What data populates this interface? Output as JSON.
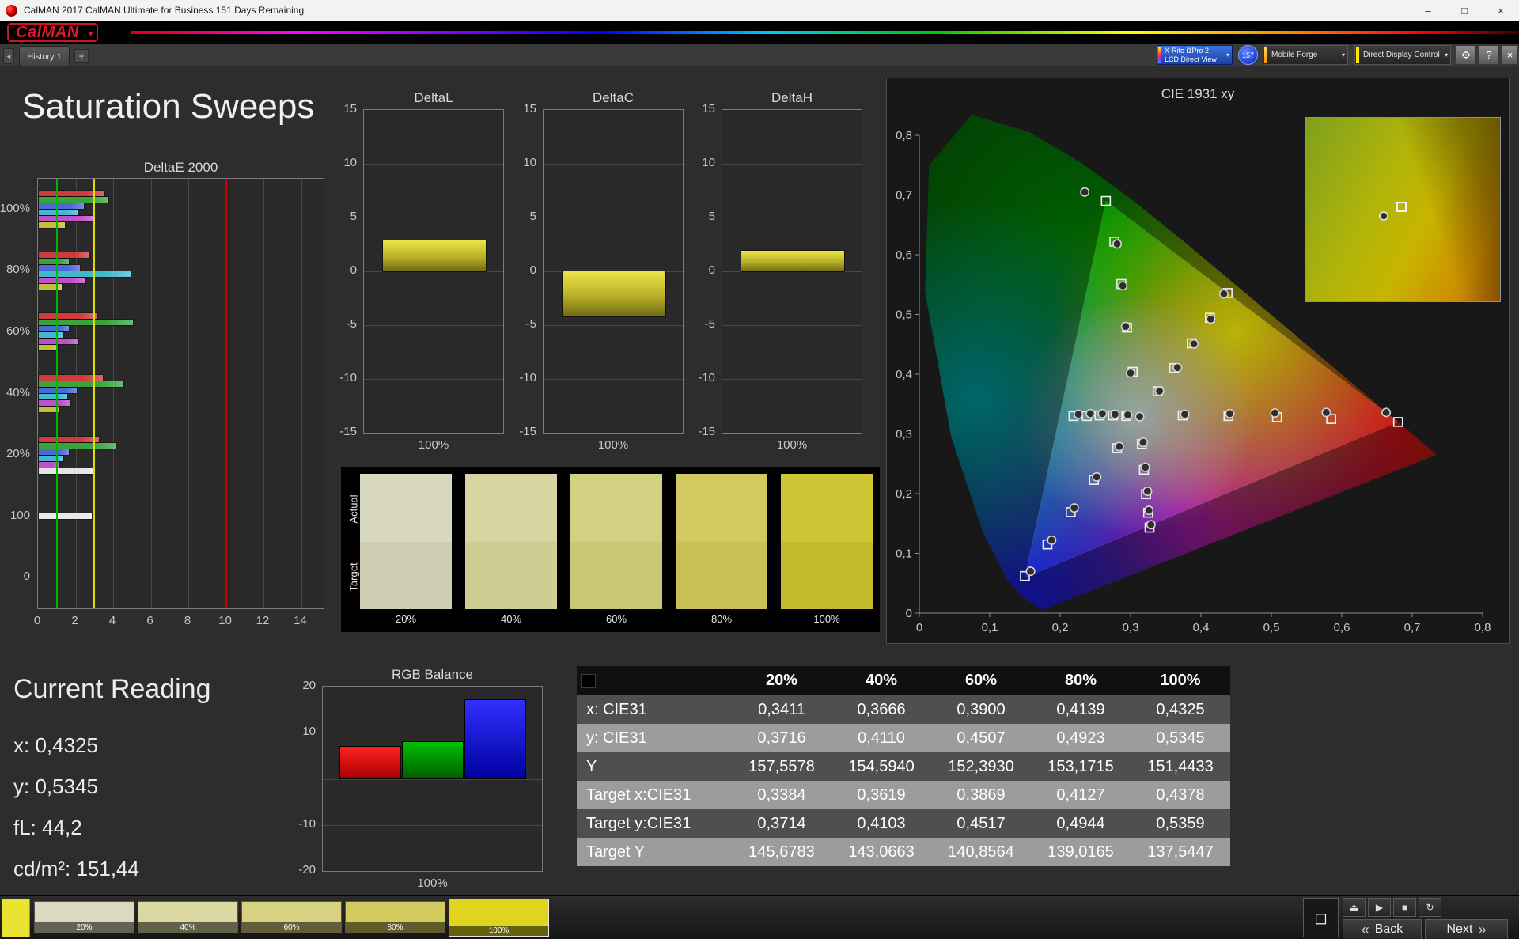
{
  "window": {
    "title": "CalMAN 2017 CalMAN Ultimate for Business 151 Days Remaining",
    "minimize": "–",
    "maximize": "□",
    "close": "×"
  },
  "brand": {
    "logo": "CalMAN",
    "caret": "▾"
  },
  "tabbar": {
    "scroll_left": "◂",
    "history_tab": "History 1",
    "add_tab": "+"
  },
  "toolbar": {
    "meter_line1": "X-Rite i1Pro 2",
    "meter_line2": "LCD Direct View",
    "badge_count": "157",
    "source_label": "Mobile Forge",
    "display_label": "Direct Display Control",
    "caret": "▾",
    "settings_icon": "⚙",
    "help_icon": "?",
    "close_icon": "×"
  },
  "page_title": "Saturation Sweeps",
  "current_reading": {
    "heading": "Current Reading",
    "lines": [
      "x: 0,4325",
      "y: 0,5345",
      "fL: 44,2",
      "cd/m²: 151,44"
    ]
  },
  "swatch_panel": {
    "actual_label": "Actual",
    "target_label": "Target",
    "columns": [
      {
        "label": "20%",
        "actual": "#d8d7bf",
        "target": "#cfceb2"
      },
      {
        "label": "40%",
        "actual": "#d8d5a0",
        "target": "#cfcc94"
      },
      {
        "label": "60%",
        "actual": "#d4d083",
        "target": "#ccc775"
      },
      {
        "label": "80%",
        "actual": "#d2ca61",
        "target": "#c9c156"
      },
      {
        "label": "100%",
        "actual": "#cfc434",
        "target": "#c5ba2b"
      }
    ]
  },
  "table": {
    "headers": [
      "20%",
      "40%",
      "60%",
      "80%",
      "100%"
    ],
    "rows": [
      {
        "label": "x: CIE31",
        "values": [
          "0,3411",
          "0,3666",
          "0,3900",
          "0,4139",
          "0,4325"
        ]
      },
      {
        "label": "y: CIE31",
        "values": [
          "0,3716",
          "0,4110",
          "0,4507",
          "0,4923",
          "0,5345"
        ]
      },
      {
        "label": "Y",
        "values": [
          "157,5578",
          "154,5940",
          "152,3930",
          "153,1715",
          "151,4433"
        ]
      },
      {
        "label": "Target x:CIE31",
        "values": [
          "0,3384",
          "0,3619",
          "0,3869",
          "0,4127",
          "0,4378"
        ]
      },
      {
        "label": "Target y:CIE31",
        "values": [
          "0,3714",
          "0,4103",
          "0,4517",
          "0,4944",
          "0,5359"
        ]
      },
      {
        "label": "Target Y",
        "values": [
          "145,6783",
          "143,0663",
          "140,8564",
          "139,0165",
          "137,5447"
        ]
      }
    ]
  },
  "bottombar": {
    "current_color": "#e9e332",
    "swatches": [
      {
        "label": "20%",
        "color": "#dbdac1"
      },
      {
        "label": "40%",
        "color": "#dbd8a2"
      },
      {
        "label": "60%",
        "color": "#d7d181"
      },
      {
        "label": "80%",
        "color": "#d3cb5f"
      },
      {
        "label": "100%",
        "color": "#e0d41e",
        "selected": true
      }
    ],
    "measure_icon": "◻",
    "tool_icons": [
      "⏏",
      "▶",
      "■",
      "↻"
    ],
    "back_chevrons": "«",
    "back_label": "Back",
    "next_label": "Next",
    "next_chevrons": "»"
  },
  "chart_data": [
    {
      "id": "deltae2000",
      "type": "bar",
      "orientation": "horizontal",
      "title": "DeltaE 2000",
      "xlim": [
        0,
        15.2
      ],
      "x_ticks": [
        0,
        2,
        4,
        6,
        8,
        10,
        12,
        14
      ],
      "reference_lines": [
        {
          "value": 1,
          "color": "#00b400"
        },
        {
          "value": 3,
          "color": "#dcdc00"
        },
        {
          "value": 10,
          "color": "#d40000"
        }
      ],
      "groups": [
        {
          "label": "100%",
          "bars": [
            {
              "color": "#d03a3a",
              "value": 3.5
            },
            {
              "color": "#3aa43a",
              "value": 3.7
            },
            {
              "color": "#4a6ad8",
              "value": 2.4
            },
            {
              "color": "#42b8cc",
              "value": 2.1
            },
            {
              "color": "#c050c8",
              "value": 2.9
            },
            {
              "color": "#c4be38",
              "value": 1.4
            }
          ]
        },
        {
          "label": "80%",
          "bars": [
            {
              "color": "#d03a3a",
              "value": 2.7
            },
            {
              "color": "#3aa43a",
              "value": 1.6
            },
            {
              "color": "#4a6ad8",
              "value": 2.2
            },
            {
              "color": "#42b8cc",
              "value": 4.9
            },
            {
              "color": "#c050c8",
              "value": 2.5
            },
            {
              "color": "#c4be38",
              "value": 1.2
            }
          ]
        },
        {
          "label": "60%",
          "bars": [
            {
              "color": "#d03a3a",
              "value": 3.1
            },
            {
              "color": "#3aa43a",
              "value": 5.0
            },
            {
              "color": "#4a6ad8",
              "value": 1.6
            },
            {
              "color": "#42b8cc",
              "value": 1.3
            },
            {
              "color": "#c050c8",
              "value": 2.1
            },
            {
              "color": "#c4be38",
              "value": 1.0
            }
          ]
        },
        {
          "label": "40%",
          "bars": [
            {
              "color": "#d03a3a",
              "value": 3.4
            },
            {
              "color": "#3aa43a",
              "value": 4.5
            },
            {
              "color": "#4a6ad8",
              "value": 2.0
            },
            {
              "color": "#42b8cc",
              "value": 1.5
            },
            {
              "color": "#c050c8",
              "value": 1.7
            },
            {
              "color": "#c4be38",
              "value": 1.1
            }
          ]
        },
        {
          "label": "20%",
          "bars": [
            {
              "color": "#d03a3a",
              "value": 3.2
            },
            {
              "color": "#3aa43a",
              "value": 4.1
            },
            {
              "color": "#4a6ad8",
              "value": 1.6
            },
            {
              "color": "#42b8cc",
              "value": 1.3
            },
            {
              "color": "#c050c8",
              "value": 1.1
            },
            {
              "color": "#e4e4e4",
              "value": 2.9
            }
          ]
        },
        {
          "label": "100",
          "bars": [
            {
              "color": "#e8e8e8",
              "value": 2.8
            }
          ]
        },
        {
          "label": "0",
          "bars": []
        }
      ]
    },
    {
      "id": "deltaL",
      "type": "bar",
      "title": "DeltaL",
      "ylim": [
        -15,
        15
      ],
      "y_ticks": [
        15,
        10,
        5,
        0,
        -5,
        -10,
        -15
      ],
      "category": "100%",
      "value": 2.9
    },
    {
      "id": "deltaC",
      "type": "bar",
      "title": "DeltaC",
      "ylim": [
        -15,
        15
      ],
      "y_ticks": [
        15,
        10,
        5,
        0,
        -5,
        -10,
        -15
      ],
      "category": "100%",
      "value": -4.2
    },
    {
      "id": "deltaH",
      "type": "bar",
      "title": "DeltaH",
      "ylim": [
        -15,
        15
      ],
      "y_ticks": [
        15,
        10,
        5,
        0,
        -5,
        -10,
        -15
      ],
      "category": "100%",
      "value": 1.9
    },
    {
      "id": "rgb_balance",
      "type": "bar",
      "title": "RGB Balance",
      "ylim": [
        -20,
        20
      ],
      "y_tick_labels": [
        20,
        10,
        -10,
        -20
      ],
      "category": "100%",
      "series": [
        {
          "name": "red",
          "color_top": "#ff2020",
          "color_bottom": "#a80000",
          "value": 7
        },
        {
          "name": "green",
          "color_top": "#00c000",
          "color_bottom": "#006000",
          "value": 8
        },
        {
          "name": "blue",
          "color_top": "#3030ff",
          "color_bottom": "#0000a0",
          "value": 17
        }
      ]
    },
    {
      "id": "cie1931",
      "type": "scatter",
      "title": "CIE 1931 xy",
      "xlim": [
        0,
        0.8
      ],
      "ylim": [
        0,
        0.9
      ],
      "x_tick_labels": [
        "0",
        "0,1",
        "0,2",
        "0,3",
        "0,4",
        "0,5",
        "0,6",
        "0,7",
        "0,8"
      ],
      "y_tick_labels": [
        "0",
        "0,1",
        "0,2",
        "0,3",
        "0,4",
        "0,5",
        "0,6",
        "0,7",
        "0,8"
      ],
      "spectral_locus": [
        [
          0.1741,
          0.005
        ],
        [
          0.144,
          0.0297
        ],
        [
          0.1241,
          0.0578
        ],
        [
          0.0913,
          0.1327
        ],
        [
          0.0454,
          0.295
        ],
        [
          0.0082,
          0.5384
        ],
        [
          0.0139,
          0.7502
        ],
        [
          0.0743,
          0.8338
        ],
        [
          0.1547,
          0.8059
        ],
        [
          0.2296,
          0.7543
        ],
        [
          0.3016,
          0.6923
        ],
        [
          0.3731,
          0.6245
        ],
        [
          0.4441,
          0.5547
        ],
        [
          0.5125,
          0.4866
        ],
        [
          0.5752,
          0.4242
        ],
        [
          0.627,
          0.3725
        ],
        [
          0.6915,
          0.3083
        ],
        [
          0.7347,
          0.2653
        ]
      ],
      "gamut_triangle": [
        [
          0.68,
          0.32
        ],
        [
          0.265,
          0.69
        ],
        [
          0.15,
          0.06
        ]
      ],
      "white_point": [
        0.313,
        0.329
      ],
      "sweeps": [
        {
          "name": "red",
          "measured": [
            [
              0.377,
              0.333
            ],
            [
              0.441,
              0.334
            ],
            [
              0.505,
              0.335
            ],
            [
              0.578,
              0.336
            ],
            [
              0.663,
              0.336
            ]
          ],
          "targets": [
            [
              0.374,
              0.331
            ],
            [
              0.439,
              0.33
            ],
            [
              0.508,
              0.328
            ],
            [
              0.585,
              0.325
            ],
            [
              0.68,
              0.32
            ]
          ]
        },
        {
          "name": "green",
          "measured": [
            [
              0.3,
              0.402
            ],
            [
              0.293,
              0.48
            ],
            [
              0.289,
              0.548
            ],
            [
              0.281,
              0.618
            ],
            [
              0.235,
              0.705
            ]
          ],
          "targets": [
            [
              0.303,
              0.404
            ],
            [
              0.295,
              0.478
            ],
            [
              0.287,
              0.551
            ],
            [
              0.277,
              0.622
            ],
            [
              0.265,
              0.69
            ]
          ]
        },
        {
          "name": "blue",
          "measured": [
            [
              0.284,
              0.279
            ],
            [
              0.252,
              0.228
            ],
            [
              0.22,
              0.176
            ],
            [
              0.188,
              0.122
            ],
            [
              0.158,
              0.07
            ]
          ],
          "targets": [
            [
              0.281,
              0.276
            ],
            [
              0.248,
              0.223
            ],
            [
              0.215,
              0.169
            ],
            [
              0.182,
              0.115
            ],
            [
              0.15,
              0.062
            ]
          ]
        },
        {
          "name": "cyan",
          "measured": [
            [
              0.296,
              0.332
            ],
            [
              0.278,
              0.333
            ],
            [
              0.26,
              0.334
            ],
            [
              0.243,
              0.334
            ],
            [
              0.226,
              0.333
            ]
          ],
          "targets": [
            [
              0.294,
              0.33
            ],
            [
              0.275,
              0.331
            ],
            [
              0.256,
              0.331
            ],
            [
              0.238,
              0.33
            ],
            [
              0.219,
              0.33
            ]
          ]
        },
        {
          "name": "magenta",
          "measured": [
            [
              0.318,
              0.286
            ],
            [
              0.321,
              0.244
            ],
            [
              0.324,
              0.204
            ],
            [
              0.326,
              0.172
            ],
            [
              0.329,
              0.148
            ]
          ],
          "targets": [
            [
              0.316,
              0.283
            ],
            [
              0.319,
              0.24
            ],
            [
              0.322,
              0.199
            ],
            [
              0.325,
              0.168
            ],
            [
              0.327,
              0.143
            ]
          ]
        },
        {
          "name": "yellow",
          "measured": [
            [
              0.3411,
              0.3716
            ],
            [
              0.3666,
              0.411
            ],
            [
              0.39,
              0.4507
            ],
            [
              0.4139,
              0.4923
            ],
            [
              0.4325,
              0.5345
            ]
          ],
          "targets": [
            [
              0.3384,
              0.3714
            ],
            [
              0.3619,
              0.4103
            ],
            [
              0.3869,
              0.4517
            ],
            [
              0.4127,
              0.4944
            ],
            [
              0.4378,
              0.5359
            ]
          ]
        }
      ],
      "inset": {
        "measured": [
          0.4325,
          0.5345
        ],
        "target": [
          0.4378,
          0.5359
        ]
      }
    }
  ]
}
